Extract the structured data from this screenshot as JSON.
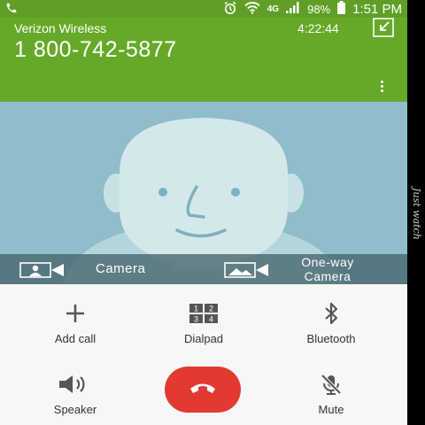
{
  "status_bar": {
    "wifi_tag": "4G",
    "battery": "98%",
    "time": "1:51 PM"
  },
  "call": {
    "carrier": "Verizon Wireless",
    "number": "1 800-742-5877",
    "timer": "4:22:44"
  },
  "camera_bar": {
    "camera_label": "Camera",
    "oneway_line1": "One-way",
    "oneway_line2": "Camera"
  },
  "controls": {
    "add_call": "Add call",
    "dialpad": "Dialpad",
    "dialpad_keys": [
      "1",
      "2",
      "3",
      "4"
    ],
    "bluetooth": "Bluetooth",
    "speaker": "Speaker",
    "mute": "Mute"
  },
  "side_text": "Just watch",
  "colors": {
    "header_green": "#66a928",
    "status_green": "#5f9f27",
    "avatar_bg": "#8fbdca",
    "end_call_red": "#e23a33"
  }
}
